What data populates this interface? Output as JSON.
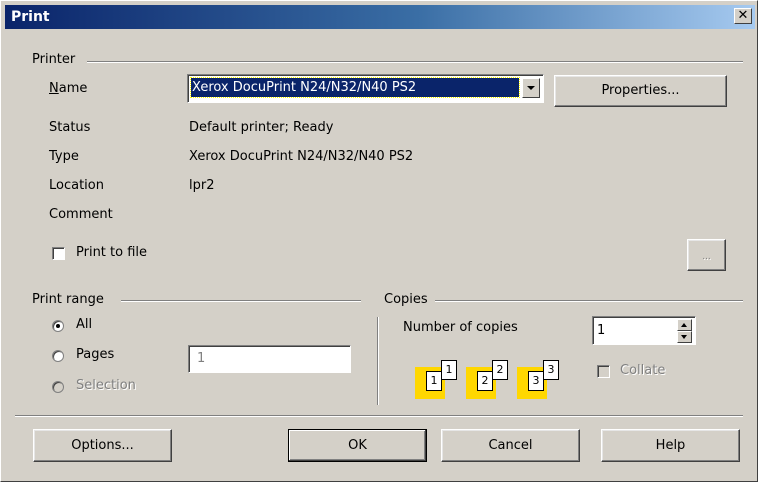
{
  "window": {
    "title": "Print",
    "close_glyph": "✕"
  },
  "printer": {
    "group_label": "Printer",
    "name_label": "Name",
    "name_value": "Xerox DocuPrint N24/N32/N40 PS2",
    "properties_button": "Properties...",
    "status_label": "Status",
    "status_value": "Default printer; Ready",
    "type_label": "Type",
    "type_value": "Xerox DocuPrint N24/N32/N40 PS2",
    "location_label": "Location",
    "location_value": "lpr2",
    "comment_label": "Comment",
    "comment_value": "",
    "print_to_file_label": "Print to file",
    "browse_button": "..."
  },
  "print_range": {
    "group_label": "Print range",
    "all_label": "All",
    "pages_label": "Pages",
    "pages_value": "1",
    "selection_label": "Selection",
    "selected": "All"
  },
  "copies": {
    "group_label": "Copies",
    "number_label": "Number of copies",
    "number_value": "1",
    "collate_label": "Collate",
    "page_icons": [
      "1",
      "1",
      "2",
      "2",
      "3",
      "3"
    ]
  },
  "buttons": {
    "options": "Options...",
    "ok": "OK",
    "cancel": "Cancel",
    "help": "Help"
  },
  "colors": {
    "title_bar_start": "#0a246a",
    "title_bar_end": "#a6caf0",
    "selection_bg": "#0a246a",
    "dialog_bg": "#d4d0c8"
  }
}
